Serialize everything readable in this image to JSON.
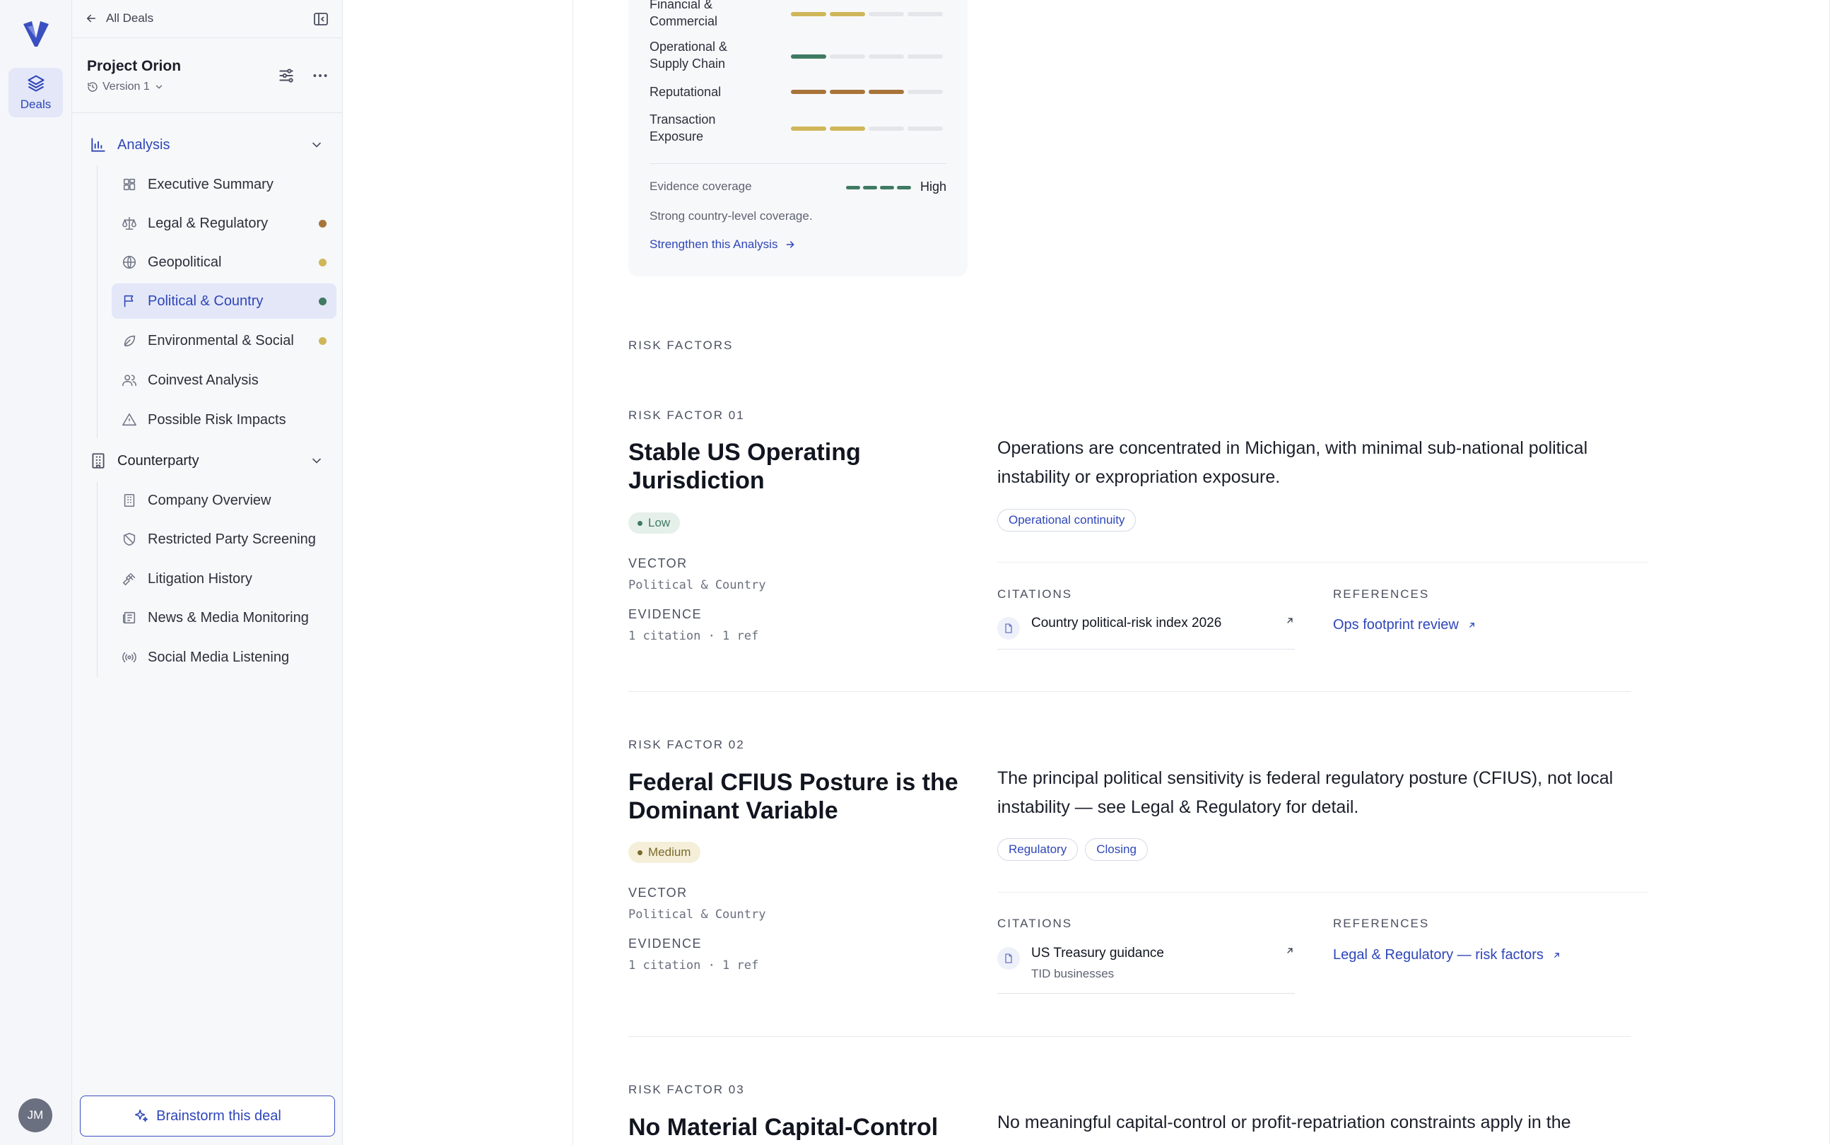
{
  "rail": {
    "deals_label": "Deals",
    "avatar": "JM"
  },
  "sidebar": {
    "back_label": "All Deals",
    "project_name": "Project Orion",
    "version": "Version 1",
    "groups": [
      {
        "label": "Analysis",
        "items": [
          {
            "label": "Executive Summary",
            "icon": "dashboard-icon"
          },
          {
            "label": "Legal & Regulatory",
            "icon": "scale-icon",
            "dot": "#a8743a"
          },
          {
            "label": "Geopolitical",
            "icon": "globe-icon",
            "dot": "#cfb659"
          },
          {
            "label": "Political & Country",
            "icon": "flag-icon",
            "dot": "#3f7a63",
            "selected": true
          },
          {
            "label": "Environmental & Social",
            "icon": "leaf-icon",
            "dot": "#cfb659"
          },
          {
            "label": "Coinvest Analysis",
            "icon": "users-icon"
          },
          {
            "label": "Possible Risk Impacts",
            "icon": "warning-icon"
          }
        ]
      },
      {
        "label": "Counterparty",
        "items": [
          {
            "label": "Company Overview",
            "icon": "building-icon"
          },
          {
            "label": "Restricted Party Screening",
            "icon": "shield-icon"
          },
          {
            "label": "Litigation History",
            "icon": "gavel-icon"
          },
          {
            "label": "News & Media Monitoring",
            "icon": "newspaper-icon"
          },
          {
            "label": "Social Media Listening",
            "icon": "broadcast-icon"
          }
        ]
      }
    ],
    "brainstorm_label": "Brainstorm this deal"
  },
  "score_card": {
    "rows": [
      {
        "name": "Financial & Commercial",
        "filled": 2,
        "color": "#cfb659"
      },
      {
        "name": "Operational & Supply Chain",
        "filled": 1,
        "color": "#3f7a63"
      },
      {
        "name": "Reputational",
        "filled": 3,
        "color": "#a8743a"
      },
      {
        "name": "Transaction Exposure",
        "filled": 2,
        "color": "#cfb659"
      }
    ],
    "coverage_label": "Evidence coverage",
    "coverage_level": "High",
    "coverage_note": "Strong country-level coverage.",
    "strengthen_label": "Strengthen this Analysis"
  },
  "section_label": "RISK FACTORS",
  "risk_factors": [
    {
      "label": "RISK FACTOR 01",
      "title": "Stable US Operating Jurisdiction",
      "severity": "Low",
      "vector_key": "VECTOR",
      "vector": "Political & Country",
      "evidence_key": "EVIDENCE",
      "evidence": "1 citation · 1 ref",
      "description": "Operations are concentrated in Michigan, with minimal sub-national political instability or expropriation exposure.",
      "tags": [
        "Operational continuity"
      ],
      "citations_label": "CITATIONS",
      "citation_title": "Country political-risk index 2026",
      "citation_sub": "",
      "references_label": "REFERENCES",
      "reference": "Ops footprint review"
    },
    {
      "label": "RISK FACTOR 02",
      "title": "Federal CFIUS Posture is the Dominant Variable",
      "severity": "Medium",
      "vector_key": "VECTOR",
      "vector": "Political & Country",
      "evidence_key": "EVIDENCE",
      "evidence": "1 citation · 1 ref",
      "description": "The principal political sensitivity is federal regulatory posture (CFIUS), not local instability — see Legal & Regulatory for detail.",
      "tags": [
        "Regulatory",
        "Closing"
      ],
      "citations_label": "CITATIONS",
      "citation_title": "US Treasury guidance",
      "citation_sub": "TID businesses",
      "references_label": "REFERENCES",
      "reference": "Legal & Regulatory — risk factors"
    },
    {
      "label": "RISK FACTOR 03",
      "title": "No Material Capital-Control",
      "description": "No meaningful capital-control or profit-repatriation constraints apply in the"
    }
  ]
}
